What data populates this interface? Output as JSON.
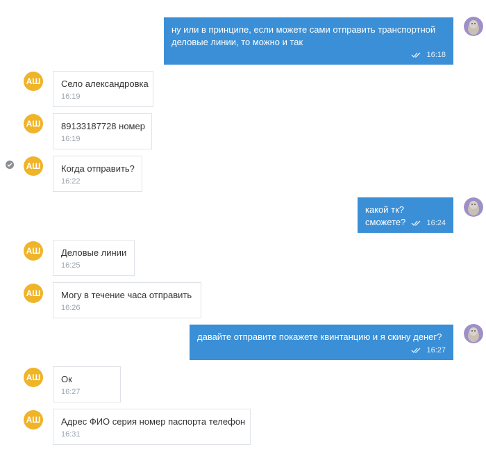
{
  "contact": {
    "initials": "АШ",
    "avatar_color": "#f0b429"
  },
  "colors": {
    "outgoing_bubble": "#3a8fd6",
    "incoming_border": "#dfe3e8",
    "time_in": "#9aa4ad"
  },
  "messages": [
    {
      "direction": "out",
      "text": "ну или в принципе, если можете сами отправить транспортной деловые линии, то можно и так",
      "time": "16:18",
      "status": "read"
    },
    {
      "direction": "in",
      "text": "Село александровка",
      "time": "16:19"
    },
    {
      "direction": "in",
      "text": "89133187728 номер",
      "time": "16:19"
    },
    {
      "direction": "in",
      "text": "Когда отправить?",
      "time": "16:22",
      "selected": true
    },
    {
      "direction": "out",
      "text": "какой тк? сможете?",
      "time": "16:24",
      "status": "read"
    },
    {
      "direction": "in",
      "text": "Деловые линии",
      "time": "16:25"
    },
    {
      "direction": "in",
      "text": "Могу в течение часа отправить",
      "time": "16:26"
    },
    {
      "direction": "out",
      "text": "давайте отправите покажете квинтанцию и я скину денег?",
      "time": "16:27",
      "status": "read"
    },
    {
      "direction": "in",
      "text": "Ок",
      "time": "16:27"
    },
    {
      "direction": "in",
      "text": "Адрес ФИО серия номер паспорта телефон",
      "time": "16:31"
    }
  ]
}
